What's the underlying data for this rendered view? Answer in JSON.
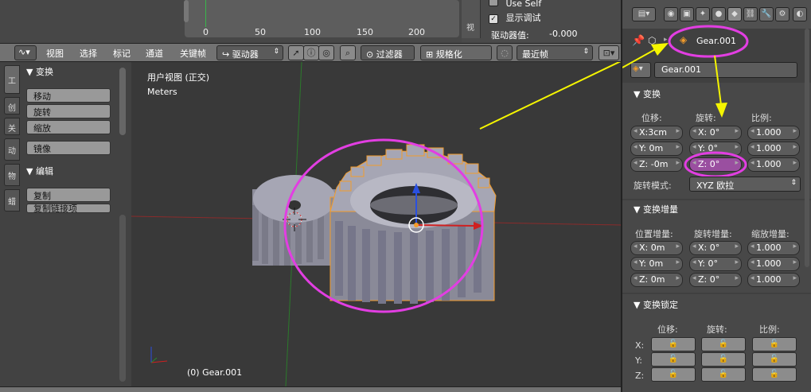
{
  "graph": {
    "ticks": [
      "0",
      "50",
      "100",
      "150",
      "200"
    ],
    "use_self": "Use Self",
    "show_debug": "显示调试",
    "driver_value_label": "驱动器值:",
    "driver_value": "-0.000",
    "side_tab": "视"
  },
  "header": {
    "menus": [
      "视图",
      "选择",
      "标记",
      "通道",
      "关键帧"
    ],
    "mode": "驱动器",
    "filter": "过滤器",
    "normalize": "规格化",
    "recent": "最近帧"
  },
  "shelf": {
    "tabs": [
      "工",
      "创",
      "关",
      "动",
      "物",
      "蜡"
    ],
    "transform_title": "变换",
    "transform_buttons": [
      "移动",
      "旋转",
      "缩放",
      "镜像"
    ],
    "edit_title": "编辑",
    "edit_buttons": [
      "复制",
      "复制链接项"
    ]
  },
  "viewport": {
    "view_name": "用户视图 (正交)",
    "units": "Meters",
    "object_label": "(0) Gear.001"
  },
  "props": {
    "breadcrumb_object": "Gear.001",
    "object_name": "Gear.001",
    "transform": {
      "title": "变换",
      "location_label": "位移:",
      "rotation_label": "旋转:",
      "scale_label": "比例:",
      "location": [
        "X:3cm",
        "Y:  0m",
        "Z: -0m"
      ],
      "rotation": [
        "X:   0°",
        "Y:   0°",
        "Z:   0°"
      ],
      "scale": [
        "1.000",
        "1.000",
        "1.000"
      ],
      "rotation_mode_label": "旋转模式:",
      "rotation_mode": "XYZ 欧拉"
    },
    "delta": {
      "title": "变换增量",
      "location_label": "位置增量:",
      "rotation_label": "旋转增量:",
      "scale_label": "缩放增量:",
      "location": [
        "X:  0m",
        "Y:  0m",
        "Z:  0m"
      ],
      "rotation": [
        "X:   0°",
        "Y:   0°",
        "Z:   0°"
      ],
      "scale": [
        "1.000",
        "1.000",
        "1.000"
      ]
    },
    "lock": {
      "title": "变换锁定",
      "location_label": "位移:",
      "rotation_label": "旋转:",
      "scale_label": "比例:",
      "axes": [
        "X:",
        "Y:",
        "Z:"
      ]
    }
  },
  "colors": {
    "highlight": "#e23ee2",
    "arrow": "#f5f500",
    "selected_outline": "#f39c2b"
  }
}
